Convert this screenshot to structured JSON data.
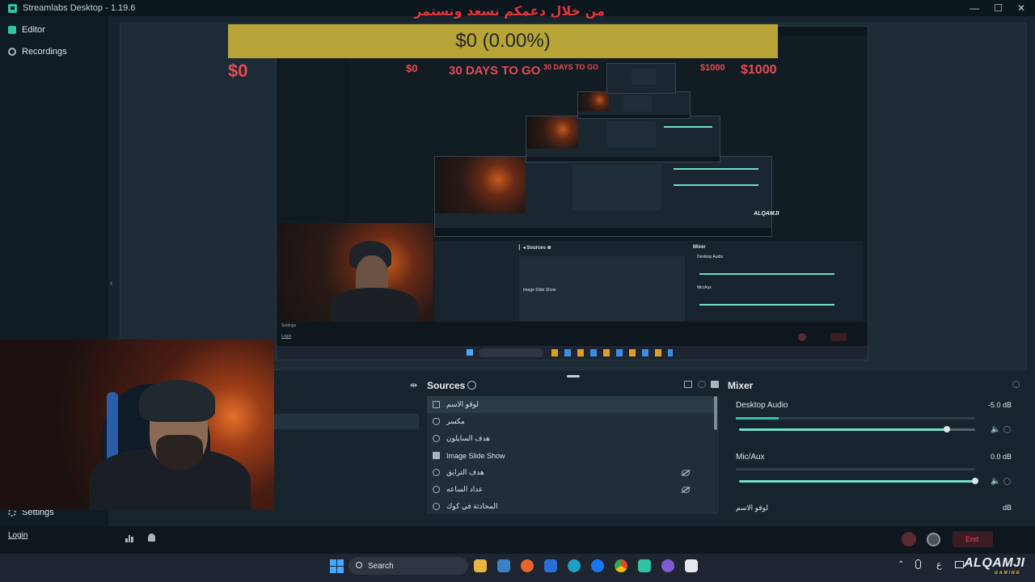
{
  "window": {
    "title": "Streamlabs Desktop - 1.19.6",
    "controls": [
      "—",
      "☐",
      "✕"
    ]
  },
  "nav": {
    "editor": "Editor",
    "recordings": "Recordings",
    "settings": "Settings",
    "login": "Login"
  },
  "overlay": {
    "rtl_title": "من خلال دعمكم نسعد ونستمر",
    "donation_amount": "$0 (0.00%)",
    "goal_start": "$0",
    "goal_end": "$1000",
    "days_left": "30 DAYS TO GO",
    "nested_start": "$0",
    "nested_days": "30 DAYS TO GO",
    "nested_end": "$1000"
  },
  "sources": {
    "title": "Sources",
    "items": [
      {
        "label": "لوقو الاسم",
        "icon": "file-icon",
        "selected": true,
        "hidden": false
      },
      {
        "label": "مكسر",
        "icon": "mic-icon",
        "selected": false,
        "hidden": false
      },
      {
        "label": "هدف الساپلون",
        "icon": "globe-icon",
        "selected": false,
        "hidden": false
      },
      {
        "label": "Image Slide Show",
        "icon": "image-icon",
        "selected": false,
        "hidden": false
      },
      {
        "label": "هدف الترايق",
        "icon": "globe-icon",
        "selected": false,
        "hidden": true
      },
      {
        "label": "عداد الساعه",
        "icon": "globe-icon",
        "selected": false,
        "hidden": true
      },
      {
        "label": "المحادثة في كوك",
        "icon": "globe-icon",
        "selected": false,
        "hidden": false
      }
    ]
  },
  "mixer": {
    "title": "Mixer",
    "channels": [
      {
        "name": "Desktop Audio",
        "db": "-5.0 dB",
        "meter_level": 0.18,
        "volume": 0.88
      },
      {
        "name": "Mic/Aux",
        "db": "0.0 dB",
        "meter_level": 0.0,
        "volume": 1.0
      },
      {
        "name": "لوقو الاسم",
        "db": "dB",
        "meter_level": 0.0,
        "volume": 1.0
      }
    ]
  },
  "statusbar": {
    "end_label": "End"
  },
  "taskbar": {
    "search_placeholder": "Search",
    "tray_lang": "ع"
  },
  "watermark": {
    "name": "ALQAMJI",
    "sub": "GAMING"
  },
  "colors": {
    "accent": "#31c3a2",
    "banner": "#b8a436",
    "goal_red": "#e84a55",
    "end_red": "#ff3d57"
  }
}
